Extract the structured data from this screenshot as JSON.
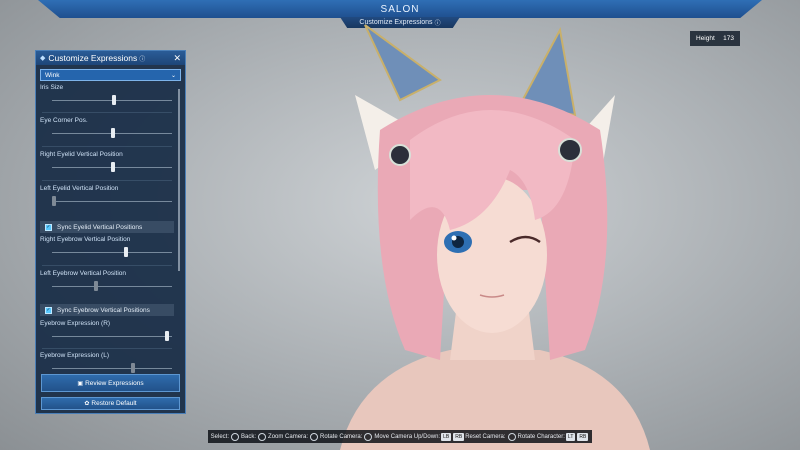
{
  "top_banner": {
    "title": "SALON",
    "subtitle": "Customize Expressions",
    "subtitle_icon": "info-icon"
  },
  "height_badge": {
    "label": "Height",
    "value": "173"
  },
  "panel": {
    "title": "Customize Expressions",
    "title_icon": "gem-icon",
    "close_icon": "close-icon",
    "dropdown": {
      "selected": "Wink"
    },
    "sliders": [
      {
        "label": "Iris Size",
        "value": 0.52
      },
      {
        "label": "Eye Corner Pos.",
        "value": 0.51
      },
      {
        "label": "Right Eyelid Vertical Position",
        "value": 0.51
      },
      {
        "label": "Left Eyelid Vertical Position",
        "value": 0.0,
        "dimmed": true
      },
      {
        "label": "Right Eyebrow Vertical Position",
        "value": 0.62
      },
      {
        "label": "Left Eyebrow Vertical Position",
        "value": 0.36,
        "dimmed": true
      },
      {
        "label": "Eyebrow Expression (R)",
        "value": 0.97
      },
      {
        "label": "Eyebrow Expression (L)",
        "value": 0.68,
        "dimmed": true
      }
    ],
    "sync_eyelid_label": "Sync Eyelid Vertical Positions",
    "sync_eyebrow_label": "Sync Eyebrow Vertical Positions",
    "sync_eyelid_checked": true,
    "sync_eyebrow_checked": true,
    "review_button": "Review Expressions",
    "restore_button": "Restore Default"
  },
  "controls": {
    "select_label": "Select:",
    "back_label": "Back:",
    "zoom_label": "Zoom Camera:",
    "rotate_label": "Rotate Camera:",
    "move_label": "Move Camera Up/Down:",
    "reset_label": "Reset Camera:",
    "rotate_char_label": "Rotate Character:",
    "key_lb_rb": "LB",
    "key_rb": "RB",
    "key_lt_rt": "LT"
  },
  "colors": {
    "banner": "#2f6fb5",
    "panel_bg": "#182c46",
    "accent": "#58c9ff",
    "hair": "#f2b9c4",
    "eye": "#2e6fb3"
  }
}
